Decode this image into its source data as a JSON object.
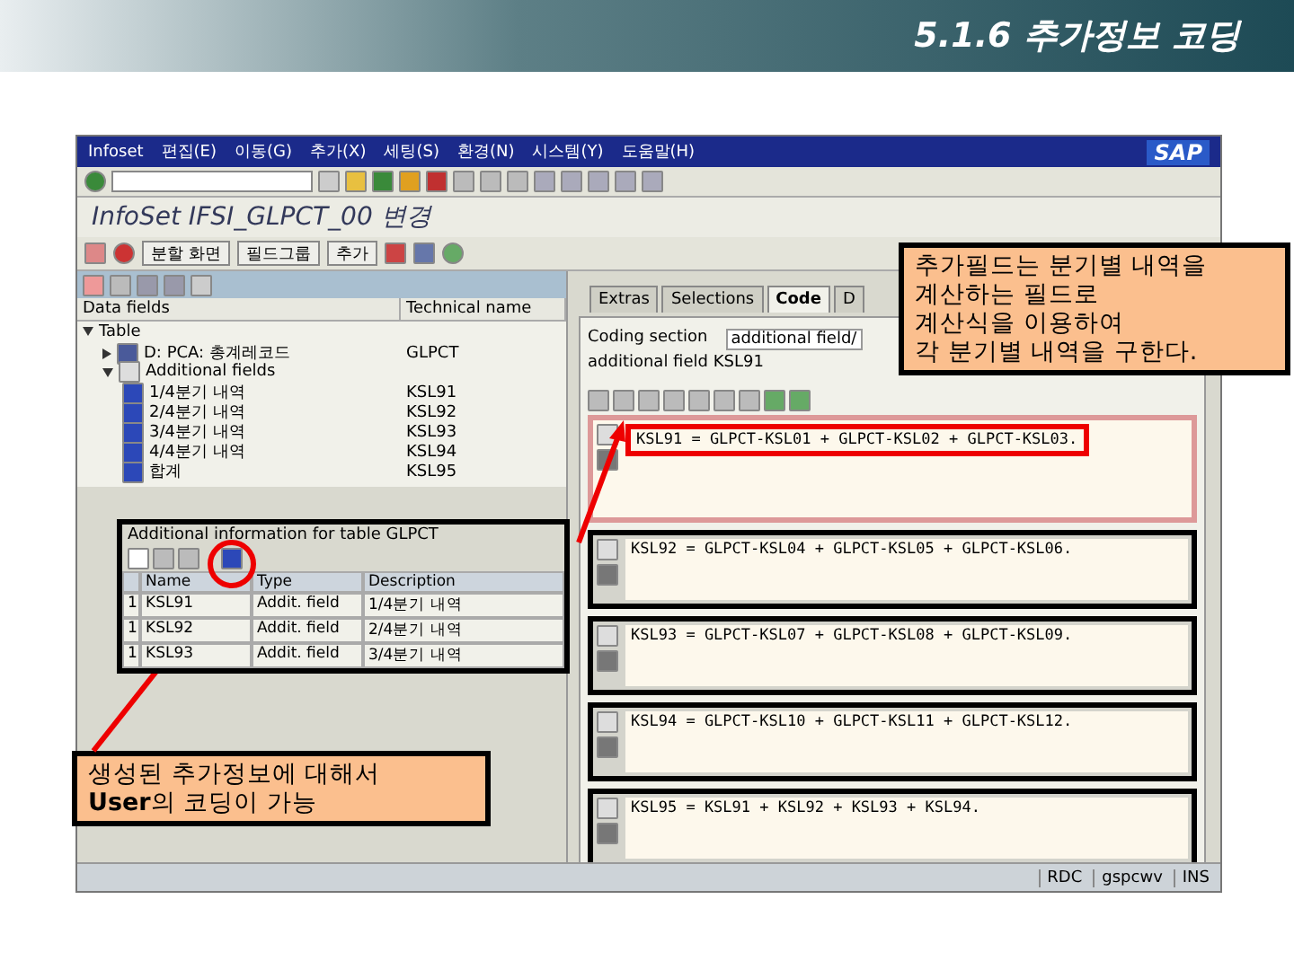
{
  "slide": {
    "title": "5.1.6 추가정보 코딩"
  },
  "window": {
    "menu": [
      "Infoset",
      "편집(E)",
      "이동(G)",
      "추가(X)",
      "세팅(S)",
      "환경(N)",
      "시스템(Y)",
      "도움말(H)"
    ],
    "logo": "SAP",
    "title": "InfoSet IFSI_GLPCT_00 변경"
  },
  "app_toolbar": [
    "분할 화면",
    "필드그룹",
    "추가"
  ],
  "tree": {
    "columns": [
      "Data fields",
      "Technical name"
    ],
    "nodes": [
      {
        "kind": "root",
        "label": "Table",
        "expanded": true,
        "children": [
          {
            "kind": "table",
            "label": "D: PCA: 총계레코드",
            "technical": "GLPCT",
            "expanded": false
          },
          {
            "kind": "folder",
            "label": "Additional fields",
            "expanded": true,
            "children": [
              {
                "kind": "field",
                "label": "1/4분기 내역",
                "technical": "KSL91"
              },
              {
                "kind": "field",
                "label": "2/4분기 내역",
                "technical": "KSL92"
              },
              {
                "kind": "field",
                "label": "3/4분기 내역",
                "technical": "KSL93"
              },
              {
                "kind": "field",
                "label": "4/4분기 내역",
                "technical": "KSL94"
              },
              {
                "kind": "field",
                "label": "합계",
                "technical": "KSL95"
              }
            ]
          }
        ]
      }
    ]
  },
  "info_table": {
    "title": "Additional information for table GLPCT",
    "columns": [
      "",
      "Name",
      "Type",
      "Description"
    ],
    "rows": [
      [
        "1",
        "KSL91",
        "Addit. field",
        "1/4분기 내역"
      ],
      [
        "1",
        "KSL92",
        "Addit. field",
        "2/4분기 내역"
      ],
      [
        "1",
        "KSL93",
        "Addit. field",
        "3/4분기 내역"
      ]
    ]
  },
  "tabs": [
    {
      "label": "Extras",
      "selected": false
    },
    {
      "label": "Selections",
      "selected": false
    },
    {
      "label": "Code",
      "selected": true
    },
    {
      "label": "D",
      "selected": false
    }
  ],
  "coding": {
    "section_label": "Coding section",
    "section_value": "additional field/",
    "field_label": "additional field KSL91"
  },
  "code_blocks": [
    {
      "kind": "main",
      "text": "KSL91 = GLPCT-KSL01 + GLPCT-KSL02 + GLPCT-KSL03."
    },
    {
      "kind": "extract",
      "text": "KSL92 = GLPCT-KSL04 + GLPCT-KSL05 + GLPCT-KSL06."
    },
    {
      "kind": "extract",
      "text": "KSL93 = GLPCT-KSL07 + GLPCT-KSL08 + GLPCT-KSL09."
    },
    {
      "kind": "extract",
      "text": "KSL94 = GLPCT-KSL10 + GLPCT-KSL11 + GLPCT-KSL12."
    },
    {
      "kind": "extract",
      "text": "KSL95 = KSL91 + KSL92 + KSL93 + KSL94."
    }
  ],
  "status_bar": [
    "RDC",
    "gspcwv",
    "INS"
  ],
  "callouts": [
    {
      "kind": "top",
      "lines": [
        "추가필드는 분기별 내역을",
        "계산하는 필드로",
        "계산식을 이용하여",
        "각 분기별 내역을 구한다."
      ]
    },
    {
      "kind": "bottom",
      "lines": [
        "생성된 추가정보에 대해서",
        "**User**의 코딩이 가능"
      ]
    }
  ]
}
